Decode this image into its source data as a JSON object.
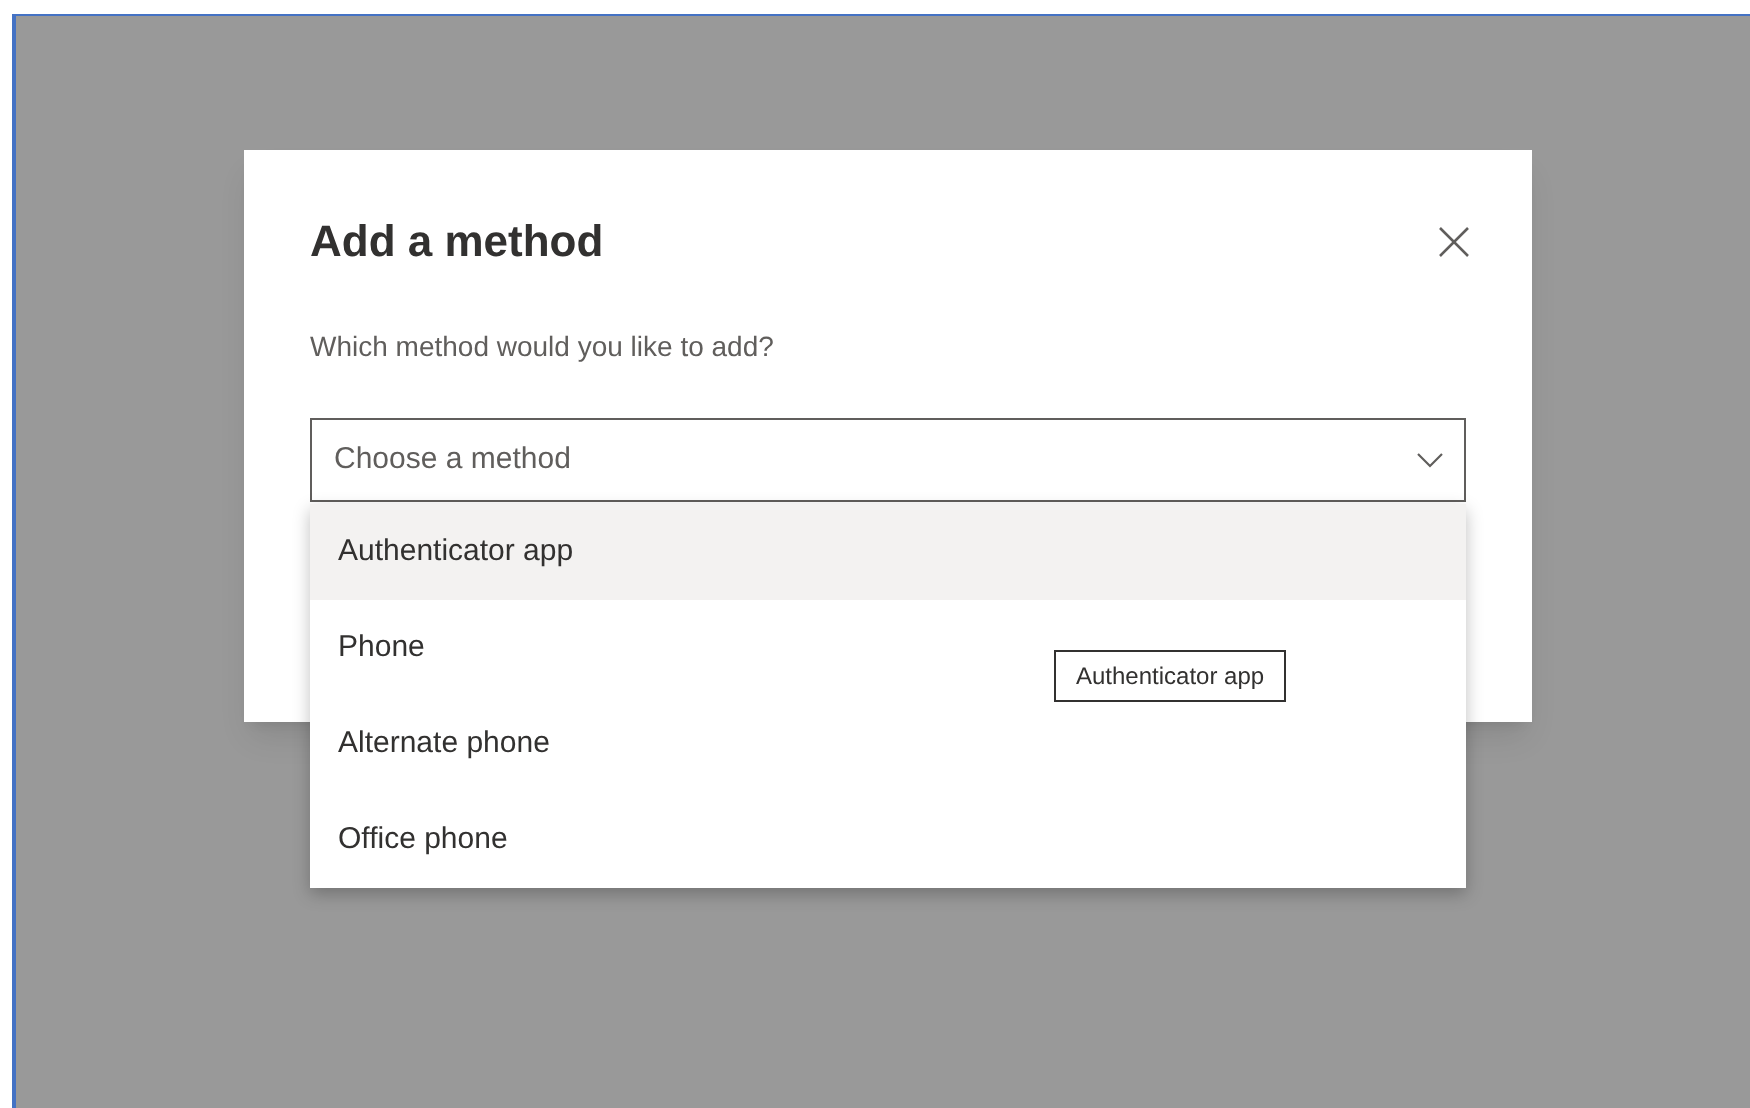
{
  "dialog": {
    "title": "Add a method",
    "question": "Which method would you like to add?"
  },
  "dropdown": {
    "placeholder": "Choose a method",
    "expanded": true,
    "options": [
      {
        "label": "Authenticator app",
        "selected": true
      },
      {
        "label": "Phone",
        "selected": false
      },
      {
        "label": "Alternate phone",
        "selected": false
      },
      {
        "label": "Office phone",
        "selected": false
      }
    ]
  },
  "tooltip": {
    "text": "Authenticator app"
  }
}
